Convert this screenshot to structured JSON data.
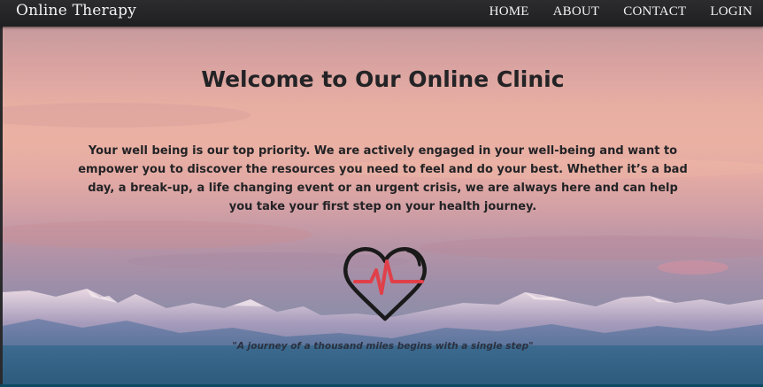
{
  "navbar": {
    "brand": "Online Therapy",
    "links": [
      {
        "label": "HOME"
      },
      {
        "label": "ABOUT"
      },
      {
        "label": "CONTACT"
      },
      {
        "label": "LOGIN"
      }
    ]
  },
  "hero": {
    "title": "Welcome to Our Online Clinic",
    "text": "Your well being is our top priority. We are actively engaged in your well-being and want to empower you to discover the resources you need to feel and do your best. Whether it’s a bad day, a break-up, a life changing event or an urgent crisis, we are always here and can help you take your first step on your health journey.",
    "icon": "heart-pulse-icon",
    "quote": "\"A journey of a thousand miles begins with a single step\""
  },
  "colors": {
    "navbar": "#1f1f21",
    "title_text": "#232326",
    "heartbeat_line": "#e0404a",
    "heart_outline": "#1a1a1a",
    "footer_line": "#0c4a63"
  }
}
